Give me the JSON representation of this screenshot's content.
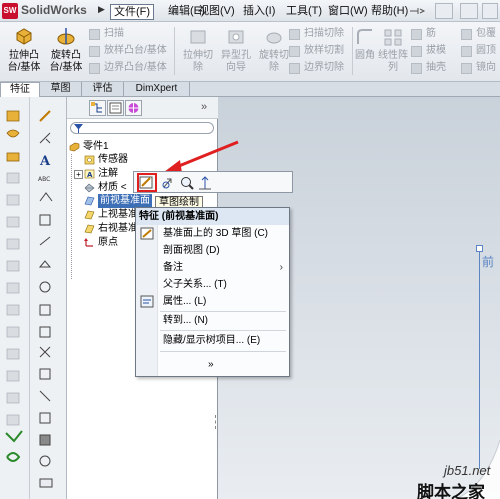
{
  "app": {
    "logo_text": "SolidWorks",
    "logo_mark": "SW"
  },
  "menu": {
    "items": [
      "文件(F)",
      "编辑(E)",
      "视图(V)",
      "插入(I)",
      "工具(T)",
      "窗口(W)",
      "帮助(H)"
    ]
  },
  "ribbon": {
    "extrude_boss": "拉伸凸\n台/基体",
    "revolve_boss": "旋转凸\n台/基体",
    "sweep": "扫描",
    "loft_boss": "放样凸台/基体",
    "boundary_boss": "边界凸台/基体",
    "extrude_cut": "拉伸切\n除",
    "hole_wizard": "异型孔\n向导",
    "revolve_cut": "旋转切\n除",
    "swept_cut": "扫描切除",
    "lofted_cut": "放样切割",
    "boundary_cut": "边界切除",
    "fillet": "圆角",
    "linear_pattern": "线性阵\n列",
    "rib": "筋",
    "draft": "拔模",
    "shell": "抽壳",
    "wrap": "包覆",
    "dome": "圆顶",
    "mirror": "镜向"
  },
  "tabs": [
    "特征",
    "草图",
    "评估",
    "DimXpert"
  ],
  "tree": {
    "items": [
      {
        "label": "零件1"
      },
      {
        "label": "传感器"
      },
      {
        "label": "注解"
      },
      {
        "label": "材质 <"
      },
      {
        "label": "前视基准面"
      },
      {
        "label": "上视基准"
      },
      {
        "label": "右视基准"
      },
      {
        "label": "原点"
      }
    ]
  },
  "context_toolbar": {
    "tooltip": "草图绘制"
  },
  "context_menu": {
    "header": "特征 (前视基准面)",
    "items": [
      {
        "label": "基准面上的 3D 草图 (C)"
      },
      {
        "label": "剖面视图 (D)"
      },
      {
        "label": "备注",
        "arrow": "›"
      },
      {
        "label": "父子关系... (T)"
      },
      {
        "label": "属性... (L)"
      },
      {
        "label": "转到... (N)"
      },
      {
        "label": "隐藏/显示树项目... (E)"
      },
      {
        "label": "»"
      }
    ]
  },
  "graphics": {
    "plane_label": "前"
  },
  "watermark": {
    "url": "jb51.net",
    "cn": "脚本之家"
  },
  "colors": {
    "accent": "#3d6fb6",
    "highlight_red": "#e02020"
  }
}
